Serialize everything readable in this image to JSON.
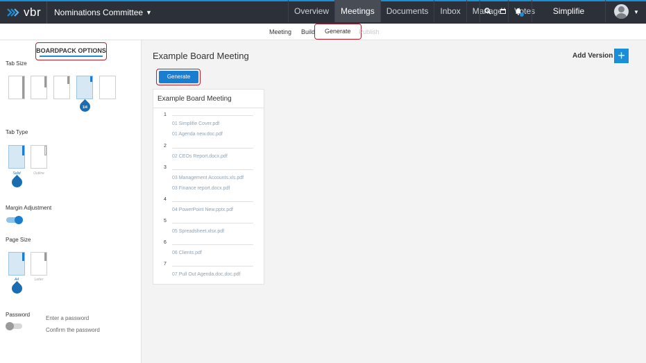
{
  "app": {
    "logo_text": "vbr",
    "committee": "Nominations Committee"
  },
  "nav": {
    "items": [
      {
        "label": "Overview",
        "active": false
      },
      {
        "label": "Meetings",
        "active": true
      },
      {
        "label": "Documents",
        "active": false
      },
      {
        "label": "Inbox",
        "active": false
      },
      {
        "label": "Manage",
        "active": false
      },
      {
        "label": "Votes",
        "active": false
      }
    ],
    "icons": [
      "search-icon",
      "calendar-icon",
      "bell-icon"
    ],
    "user_name": "Simplifie"
  },
  "subtabs": {
    "meeting": "Meeting",
    "build": "Build",
    "generate": "Generate",
    "publish": "Publish"
  },
  "sidebar": {
    "title": "BOARDPACK OPTIONS",
    "tab_size": {
      "label": "Tab Size",
      "selected_value": "1/4"
    },
    "tab_type": {
      "label": "Tab Type",
      "options": [
        "Solid",
        "Outline"
      ],
      "selected": "Solid"
    },
    "margin_adjustment": {
      "label": "Margin Adjustment",
      "enabled": true
    },
    "page_size": {
      "label": "Page Size",
      "options": [
        "A4",
        "Letter"
      ],
      "selected": "A4"
    },
    "password": {
      "label": "Password",
      "enabled": false,
      "placeholder_enter": "Enter a password",
      "placeholder_confirm": "Confirm the password"
    }
  },
  "main": {
    "title": "Example Board Meeting",
    "add_version_label": "Add Version",
    "generate_label": "Generate",
    "card": {
      "title": "Example Board Meeting",
      "items": [
        {
          "num": "1",
          "files": [
            "01 Simplifie Cover.pdf",
            "01 Agenda new.doc.pdf"
          ]
        },
        {
          "num": "2",
          "files": [
            "02 CEOs Report.docx.pdf"
          ]
        },
        {
          "num": "3",
          "files": [
            "03 Management Accounts.xls.pdf",
            "03 Finance report.docx.pdf"
          ]
        },
        {
          "num": "4",
          "files": [
            "04 PowerPoint New.pptx.pdf"
          ]
        },
        {
          "num": "5",
          "files": [
            "05 Spreadsheet.xlsx.pdf"
          ]
        },
        {
          "num": "6",
          "files": [
            "06 Clients.pdf"
          ]
        },
        {
          "num": "7",
          "files": [
            "07 Pull Out Agenda.doc.doc.pdf"
          ]
        }
      ]
    }
  },
  "colors": {
    "accent": "#1a8fd8",
    "highlight_outline": "#b21f2d",
    "topbar": "#2c3038"
  }
}
